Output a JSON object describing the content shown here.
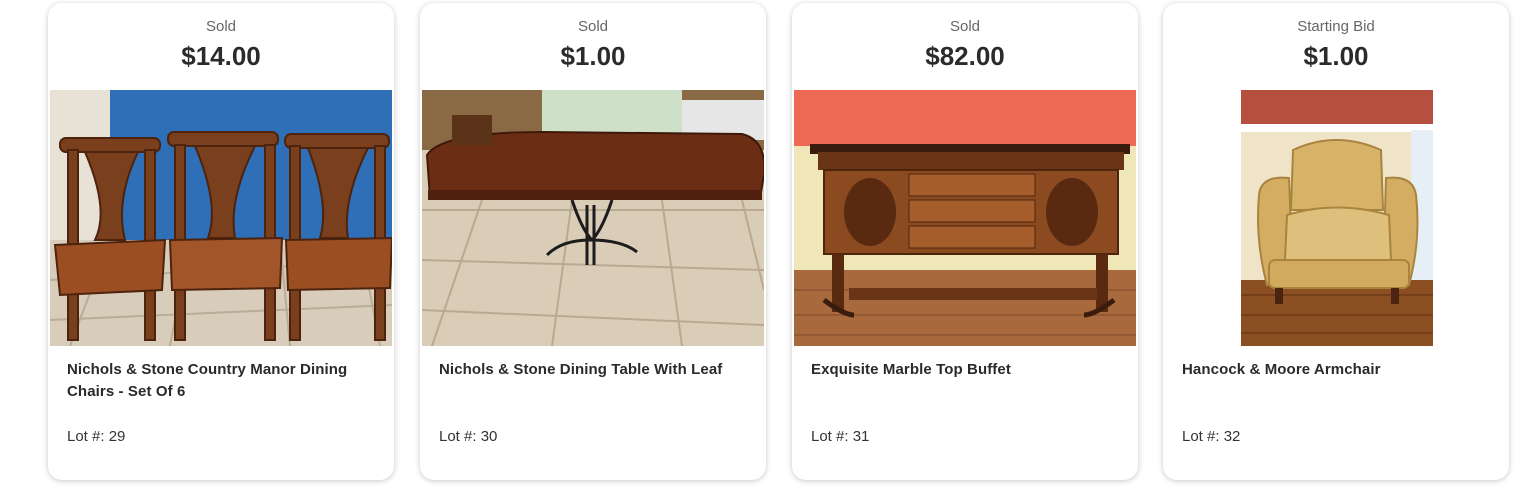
{
  "lots": [
    {
      "status": "Sold",
      "price": "$14.00",
      "title": "Nichols & Stone Country Manor Dining Chairs - Set Of 6",
      "lot_label": "Lot #: 29"
    },
    {
      "status": "Sold",
      "price": "$1.00",
      "title": "Nichols & Stone Dining Table With Leaf",
      "lot_label": "Lot #: 30"
    },
    {
      "status": "Sold",
      "price": "$82.00",
      "title": "Exquisite Marble Top Buffet",
      "lot_label": "Lot #: 31"
    },
    {
      "status": "Starting Bid",
      "price": "$1.00",
      "title": "Hancock & Moore Armchair",
      "lot_label": "Lot #: 32"
    }
  ],
  "photos": [
    "dining-chairs-photo",
    "dining-table-photo",
    "buffet-photo",
    "armchair-photo"
  ]
}
